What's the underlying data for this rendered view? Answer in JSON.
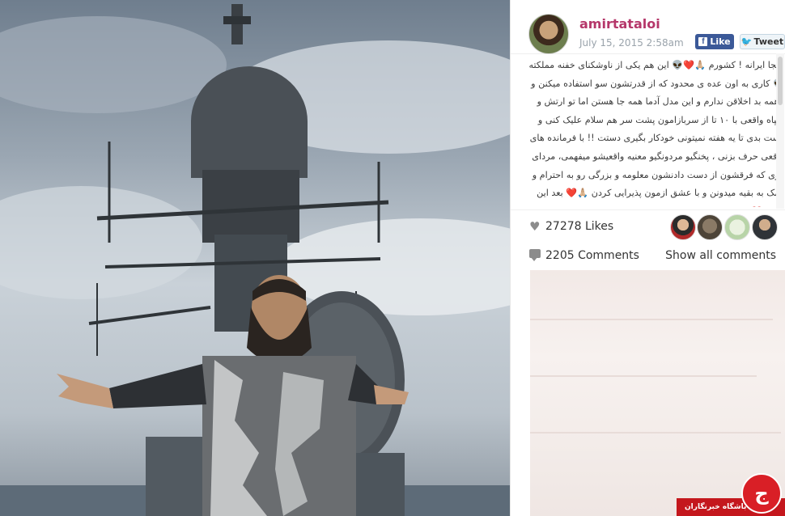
{
  "post": {
    "username": "amirtataloi",
    "date": "July 15, 2015 2:58am",
    "caption": "اینجا ایرانه ! کشورم 🙏🏼❤️👽 این هم یکی از ناوشکنای خفنه مملکته 👽 کاری به اون عده ی محدود که از قدرتشون سو استفاده میکنن و باهمه بد اخلاقن ندارم و این مدل آدما همه جا هستن اما تو ارتش و سپاه واقعی با ۱۰ تا از سربازامون پشت سر هم سلام علیک کنی و دست بدی تا یه هفته نمیتونی خودکار بگیری دستت !! با فرمانده های واقعی حرف بزنی ، پخنگیو مردونگیو معنیه واقعیشو میفهمی، مردای قوی که فرقشون از دست دادنشون معلومه و بزرگی رو به احترام و کمک به بقیه میدونن و با عشق ازمون پذیرایی کردن 🙏🏼❤️ بعد این ویدئو ❤️",
    "likes": "27278 Likes",
    "comments": "2205 Comments",
    "show_all": "Show all comments"
  },
  "share": {
    "like_label": "Like",
    "tweet_label": "Tweet"
  },
  "icons": {
    "heart": "heart-icon",
    "comment": "comment-bubble-icon",
    "facebook": "facebook-icon",
    "twitter": "twitter-bird-icon"
  },
  "colors": {
    "username": "#b5376a",
    "facebook": "#3b5998",
    "badge": "#c4171d"
  },
  "badge": {
    "text": "باشگاه خبرنگاران"
  }
}
